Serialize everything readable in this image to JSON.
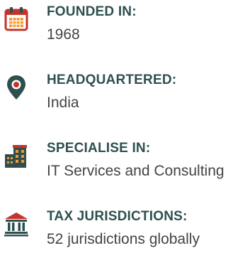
{
  "colors": {
    "accent": "#c3342d",
    "heading": "#2f4f4f",
    "value": "#444444",
    "icon_orange": "#f59a2e",
    "icon_dark": "#2f4f4f"
  },
  "facts": [
    {
      "icon": "calendar-icon",
      "heading": "FOUNDED IN:",
      "value": "1968"
    },
    {
      "icon": "location-pin-icon",
      "heading": "HEADQUARTERED:",
      "value": "India"
    },
    {
      "icon": "office-building-icon",
      "heading": "SPECIALISE IN:",
      "value": "IT Services and Consulting"
    },
    {
      "icon": "government-building-icon",
      "heading": "TAX JURISDICTIONS:",
      "value": "52 jurisdictions globally"
    }
  ]
}
